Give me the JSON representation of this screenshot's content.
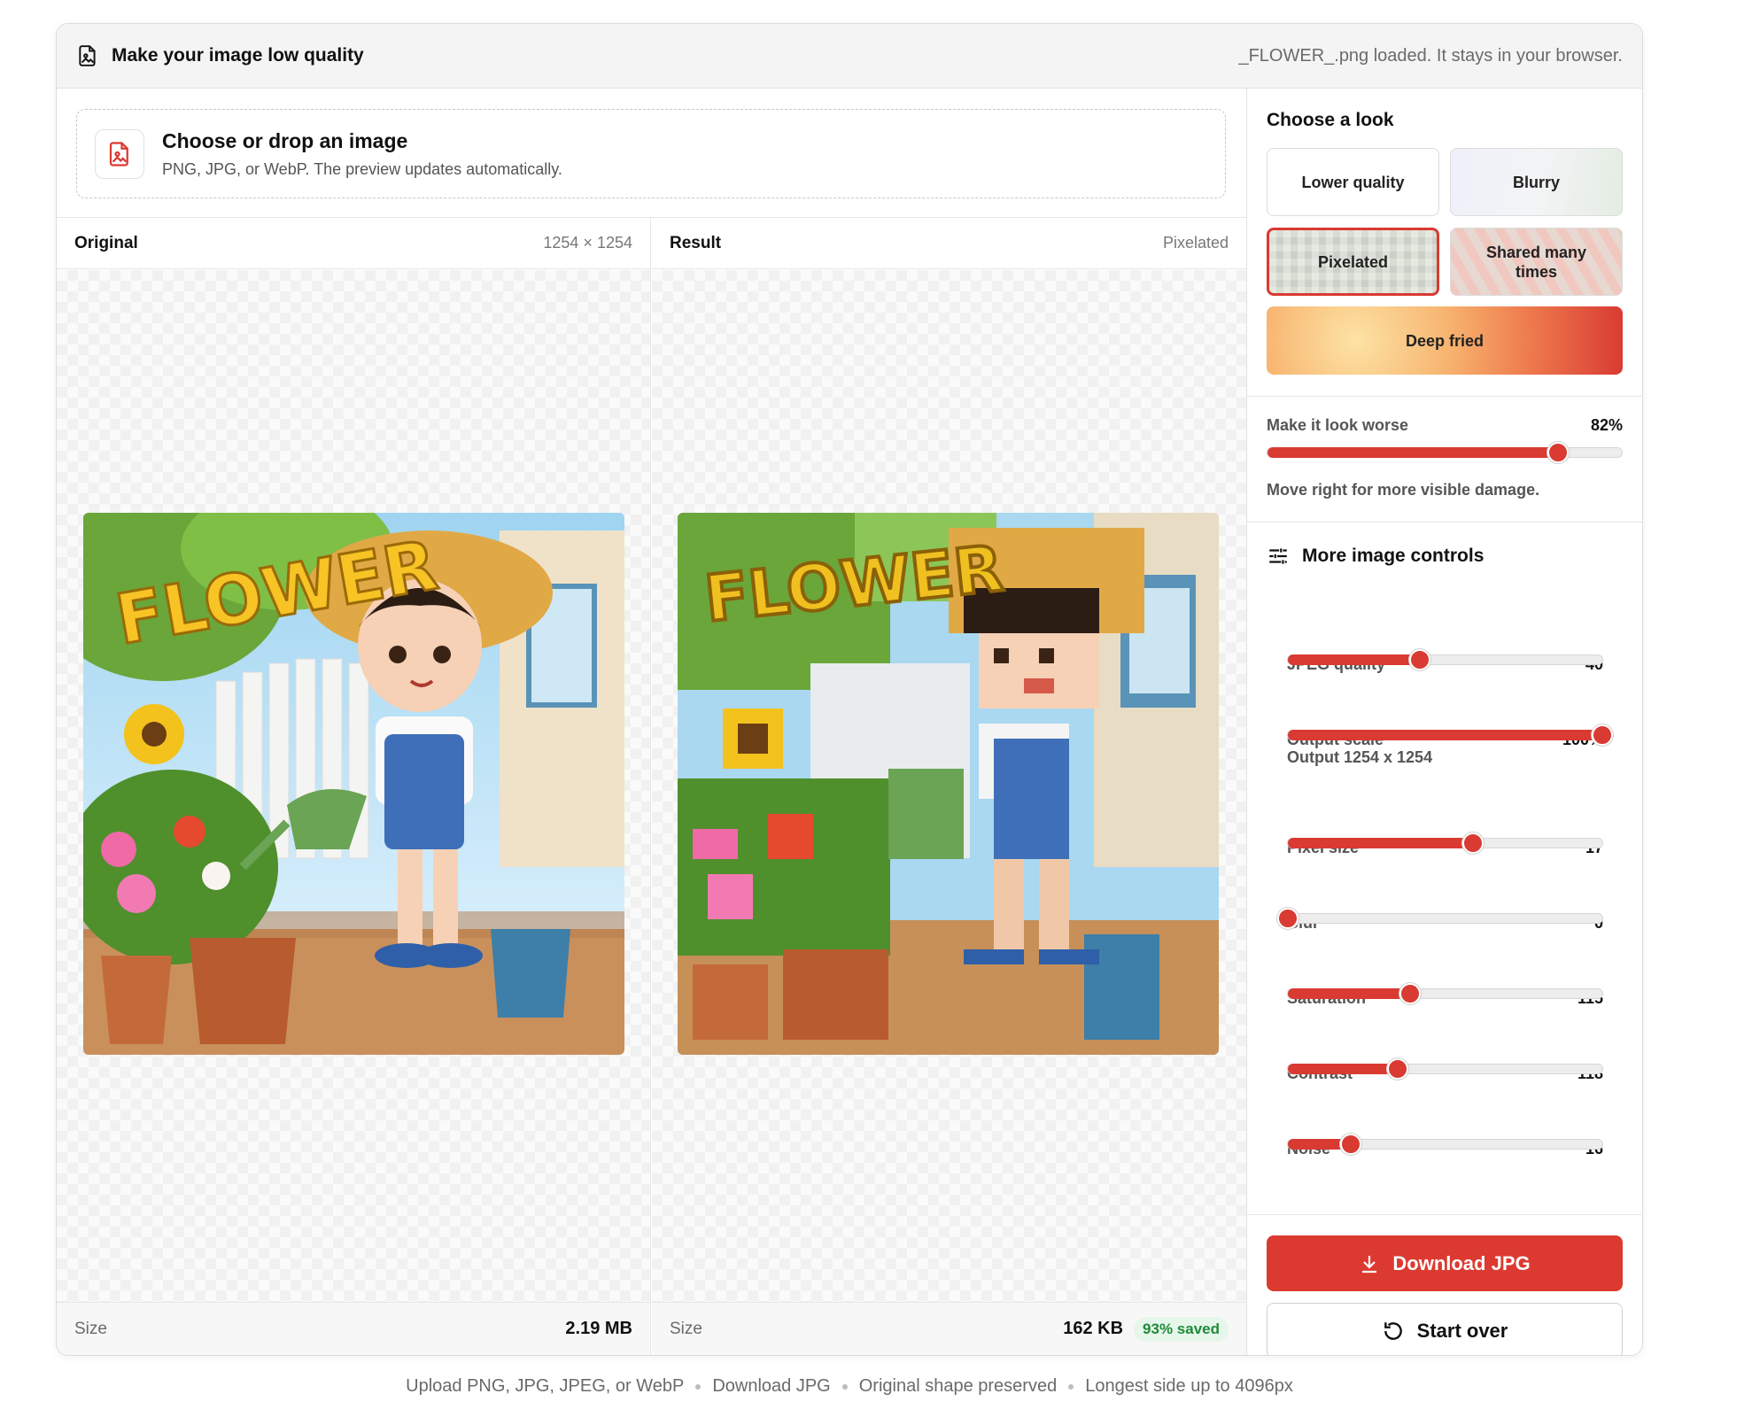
{
  "header": {
    "title": "Make your image low quality",
    "status": "_FLOWER_.png loaded. It stays in your browser."
  },
  "dropzone": {
    "title": "Choose or drop an image",
    "subtitle": "PNG, JPG, or WebP. The preview updates automatically."
  },
  "original": {
    "label": "Original",
    "dimensions": "1254 × 1254",
    "size_label": "Size",
    "size_value": "2.19 MB",
    "image_alt": "FLOWER"
  },
  "result": {
    "label": "Result",
    "mode": "Pixelated",
    "size_label": "Size",
    "size_value": "162 KB",
    "saved": "93% saved",
    "image_alt": "FLOWER"
  },
  "looks": {
    "title": "Choose a look",
    "items": [
      {
        "label": "Lower quality",
        "selected": false
      },
      {
        "label": "Blurry",
        "selected": false
      },
      {
        "label": "Pixelated",
        "selected": true
      },
      {
        "label": "Shared many times",
        "selected": false
      },
      {
        "label": "Deep fried",
        "selected": false
      }
    ]
  },
  "worse": {
    "label": "Make it look worse",
    "value_text": "82%",
    "value": 82,
    "help": "Move right for more visible damage."
  },
  "controls": {
    "title": "More image controls",
    "output_note": "Output 1254 x 1254",
    "items": [
      {
        "label": "JPEG quality",
        "value_text": "40",
        "fraction": 0.42
      },
      {
        "label": "Output scale",
        "value_text": "100%",
        "fraction": 1.0
      },
      {
        "label": "Pixel size",
        "value_text": "17",
        "fraction": 0.59
      },
      {
        "label": "Blur",
        "value_text": "0",
        "fraction": 0.0
      },
      {
        "label": "Saturation",
        "value_text": "115",
        "fraction": 0.39
      },
      {
        "label": "Contrast",
        "value_text": "118",
        "fraction": 0.35
      },
      {
        "label": "Noise",
        "value_text": "16",
        "fraction": 0.2
      }
    ]
  },
  "actions": {
    "download": "Download JPG",
    "start_over": "Start over"
  },
  "footer": {
    "items": [
      "Upload PNG, JPG, JPEG, or WebP",
      "Download JPG",
      "Original shape preserved",
      "Longest side up to 4096px"
    ]
  },
  "colors": {
    "accent": "#dc3a30",
    "saved_green": "#1f8a3b"
  }
}
